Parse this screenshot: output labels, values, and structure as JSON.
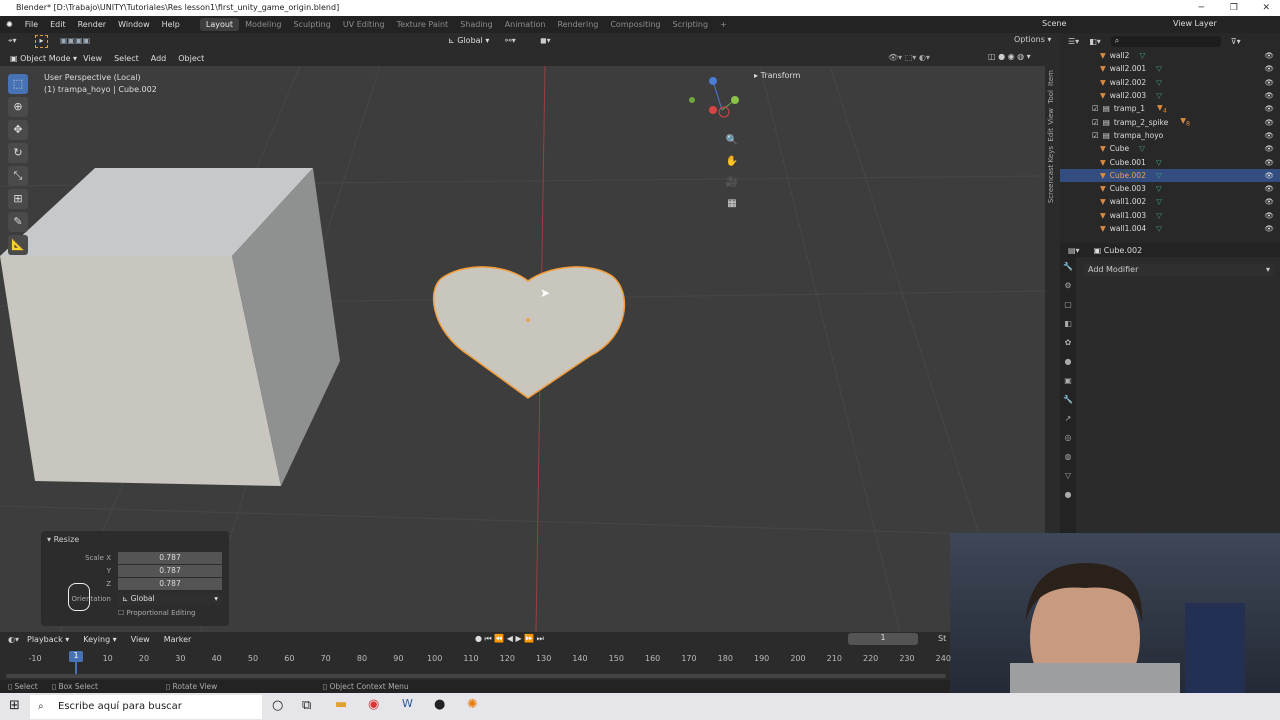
{
  "window": {
    "title": "Blender* [D:\\Trabajo\\UNITY\\Tutoriales\\Res lesson1\\first_unity_game_origin.blend]"
  },
  "menu": [
    "File",
    "Edit",
    "Render",
    "Window",
    "Help"
  ],
  "workspaces": [
    {
      "label": "Layout",
      "active": true
    },
    {
      "label": "Modeling"
    },
    {
      "label": "Sculpting"
    },
    {
      "label": "UV Editing"
    },
    {
      "label": "Texture Paint"
    },
    {
      "label": "Shading"
    },
    {
      "label": "Animation"
    },
    {
      "label": "Rendering"
    },
    {
      "label": "Compositing"
    },
    {
      "label": "Scripting"
    }
  ],
  "scene": "Scene",
  "view_layer": "View Layer",
  "tool_header": {
    "orientation": "Global",
    "options": "Options"
  },
  "viewport_header": {
    "mode": "Object Mode",
    "menus": [
      "View",
      "Select",
      "Add",
      "Object"
    ]
  },
  "viewport": {
    "perspective": "User Perspective (Local)",
    "object": "(1) trampa_hoyo | Cube.002",
    "transform_panel": "Transform"
  },
  "side_tabs": [
    "Item",
    "Tool",
    "View",
    "Edit",
    "Screencast Keys"
  ],
  "outliner": [
    {
      "name": "wall2",
      "type": "mesh"
    },
    {
      "name": "wall2.001",
      "type": "mesh"
    },
    {
      "name": "wall2.002",
      "type": "mesh"
    },
    {
      "name": "wall2.003",
      "type": "mesh"
    },
    {
      "name": "tramp_1",
      "type": "collection",
      "badge": "4"
    },
    {
      "name": "tramp_2_spike",
      "type": "collection",
      "badge": "8"
    },
    {
      "name": "trampa_hoyo",
      "type": "collection"
    },
    {
      "name": "Cube",
      "type": "mesh"
    },
    {
      "name": "Cube.001",
      "type": "mesh"
    },
    {
      "name": "Cube.002",
      "type": "mesh",
      "selected": true
    },
    {
      "name": "Cube.003",
      "type": "mesh"
    },
    {
      "name": "wall1.002",
      "type": "mesh"
    },
    {
      "name": "wall1.003",
      "type": "mesh"
    },
    {
      "name": "wall1.004",
      "type": "mesh"
    }
  ],
  "properties": {
    "object": "Cube.002",
    "add_modifier": "Add Modifier"
  },
  "resize_panel": {
    "title": "Resize",
    "scale_x_label": "Scale X",
    "y_label": "Y",
    "z_label": "Z",
    "x": "0.787",
    "y": "0.787",
    "z": "0.787",
    "orientation_label": "Orientation",
    "orientation": "Global",
    "proportional": "Proportional Editing"
  },
  "timeline": {
    "menus": [
      "Playback",
      "Keying",
      "View",
      "Marker"
    ],
    "current_frame": "1",
    "ticks": [
      "-10",
      "10",
      "20",
      "30",
      "40",
      "50",
      "60",
      "70",
      "80",
      "90",
      "100",
      "110",
      "120",
      "130",
      "140",
      "150",
      "160",
      "170",
      "180",
      "190",
      "200",
      "210",
      "220",
      "230",
      "240"
    ],
    "start_label": "St"
  },
  "status": {
    "select": "Select",
    "box_select": "Box Select",
    "rotate": "Rotate View",
    "context": "Object Context Menu"
  },
  "taskbar": {
    "search_placeholder": "Escribe aquí para buscar"
  },
  "colors": {
    "accent": "#4772b3",
    "selection": "#e08a3c",
    "mesh_data": "#3ea187"
  }
}
